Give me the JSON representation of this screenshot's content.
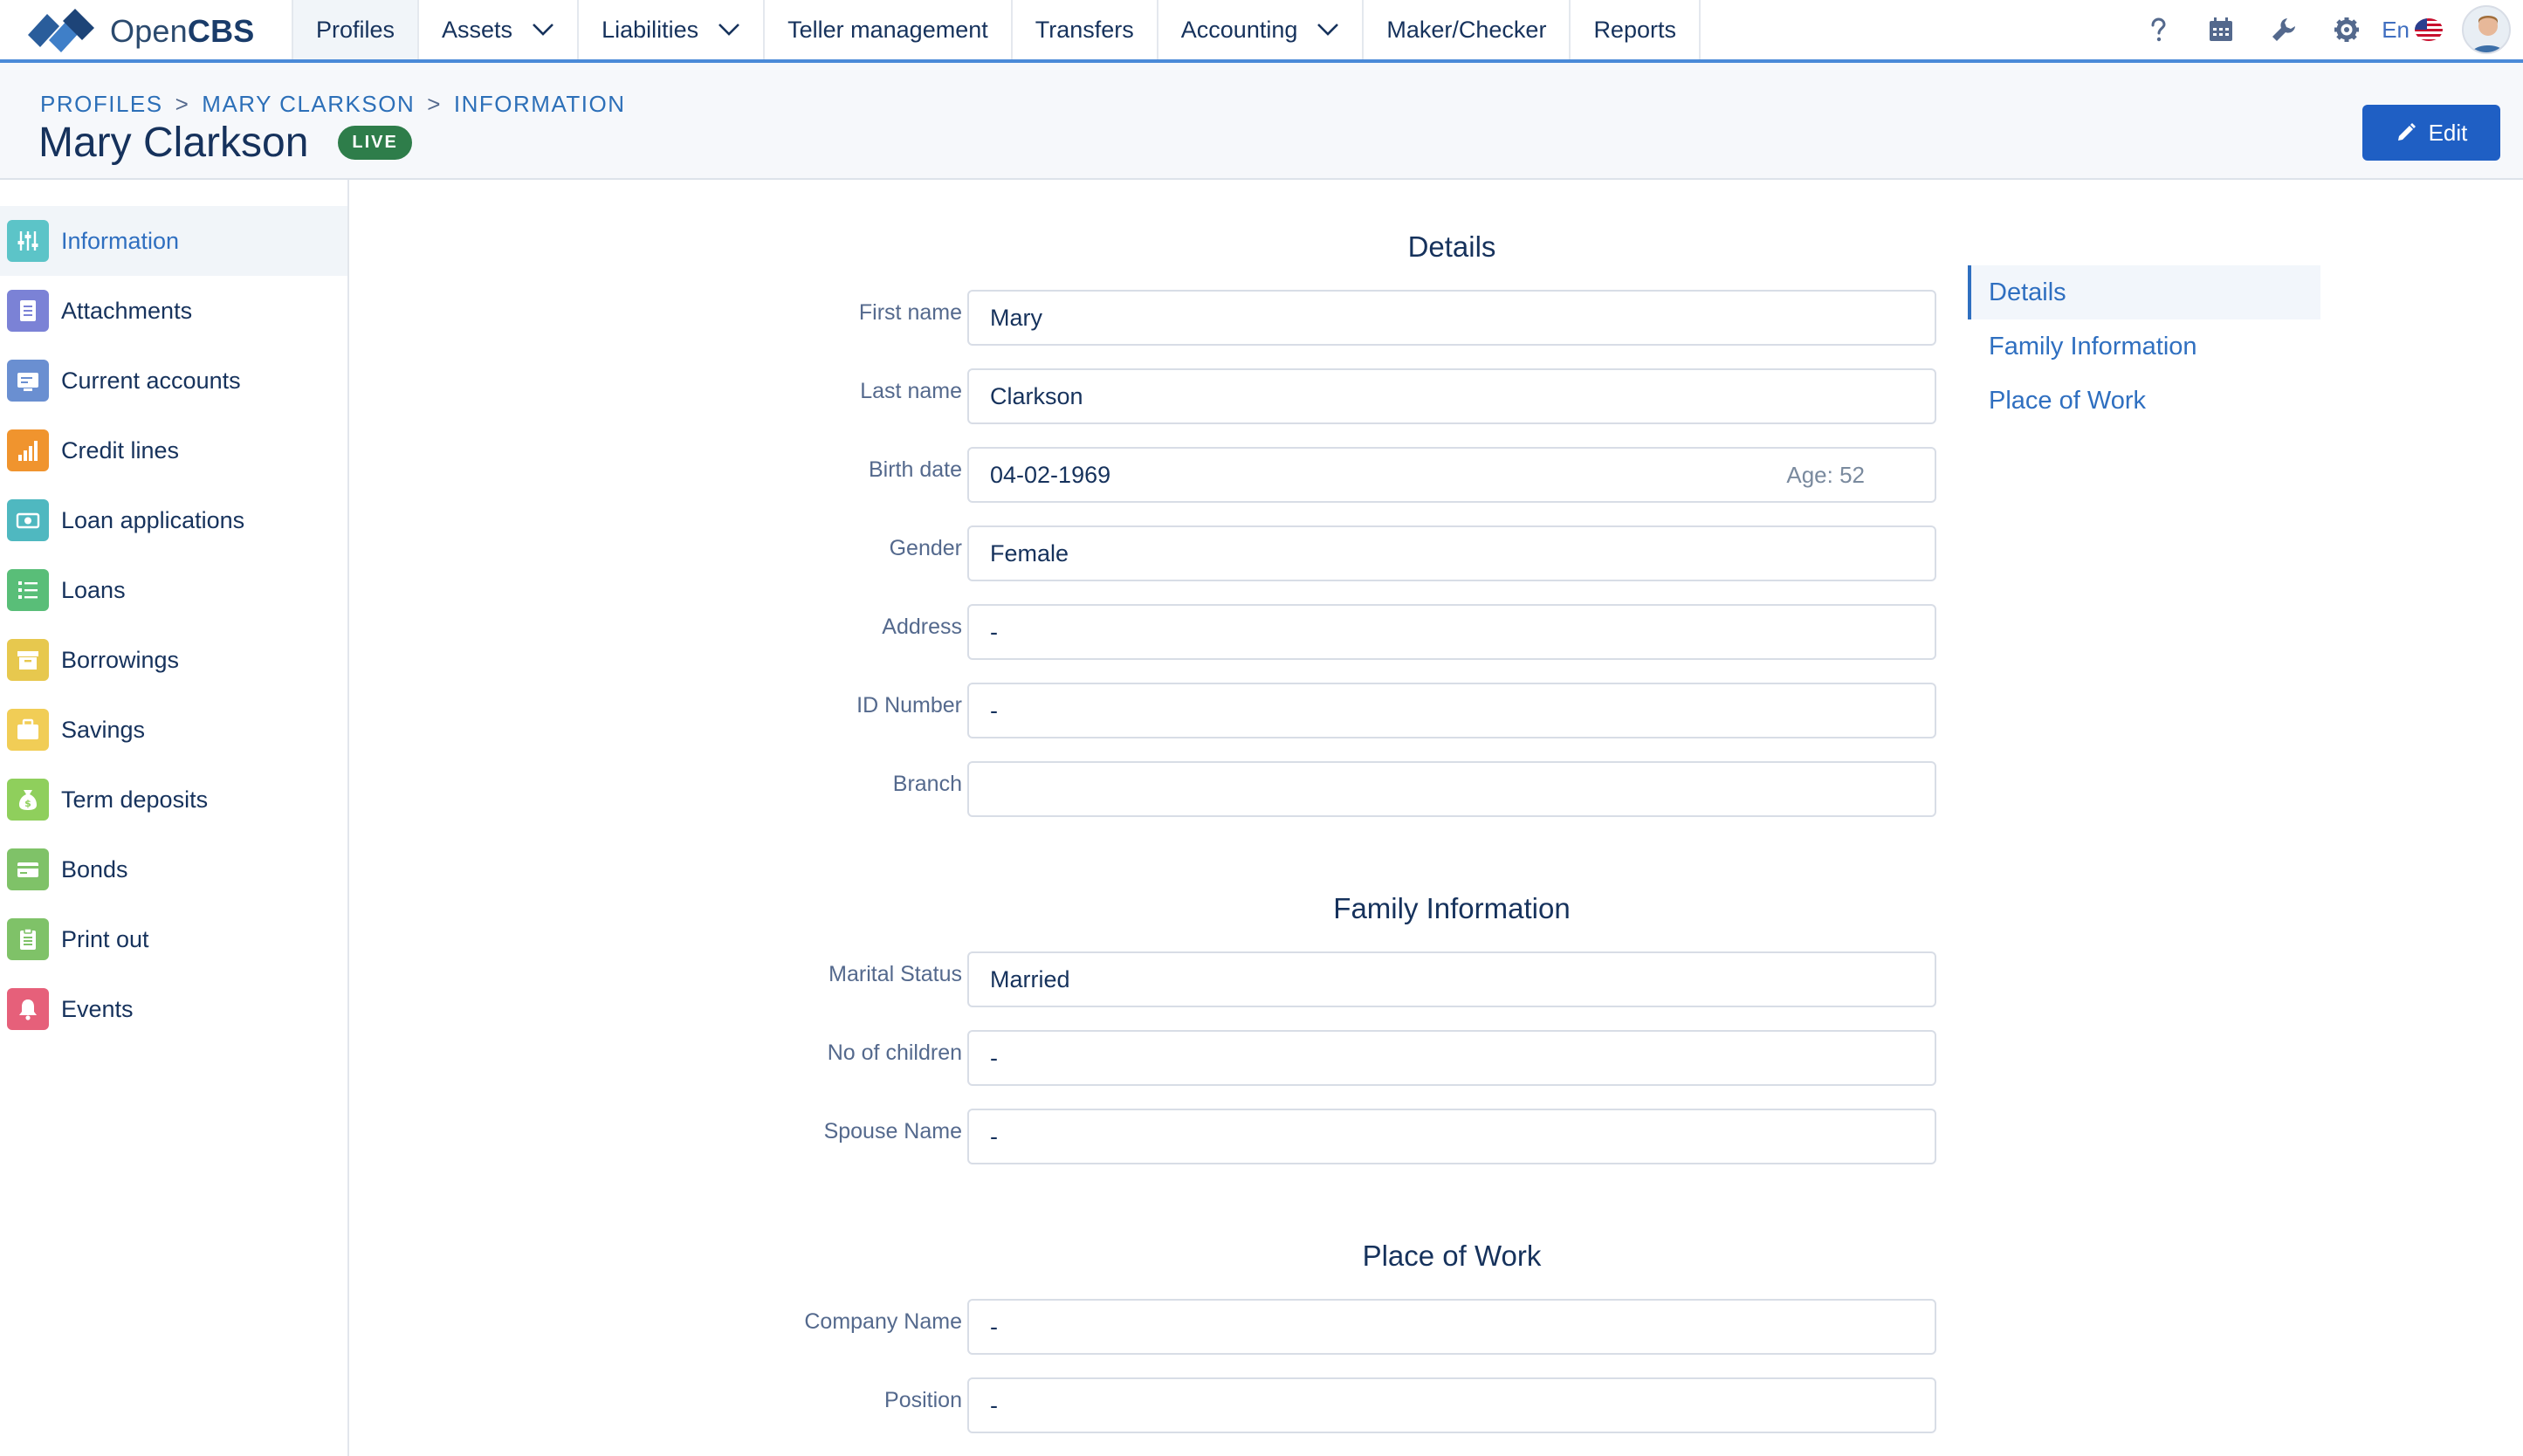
{
  "app": {
    "logo_prefix": "Open",
    "logo_suffix": "CBS"
  },
  "nav": {
    "items": [
      {
        "label": "Profiles",
        "has_menu": false,
        "active": true
      },
      {
        "label": "Assets",
        "has_menu": true
      },
      {
        "label": "Liabilities",
        "has_menu": true
      },
      {
        "label": "Teller management",
        "has_menu": false
      },
      {
        "label": "Transfers",
        "has_menu": false
      },
      {
        "label": "Accounting",
        "has_menu": true
      },
      {
        "label": "Maker/Checker",
        "has_menu": false
      },
      {
        "label": "Reports",
        "has_menu": false
      }
    ],
    "tools": [
      "help-icon",
      "calendar-icon",
      "wrench-icon",
      "gear-icon"
    ],
    "language": "En"
  },
  "header": {
    "breadcrumb": [
      "PROFILES",
      "MARY CLARKSON",
      "INFORMATION"
    ],
    "breadcrumb_sep": ">",
    "title": "Mary Clarkson",
    "status_badge": "LIVE",
    "edit_label": "Edit"
  },
  "sidebar": {
    "items": [
      {
        "label": "Information",
        "icon": "sliders-icon",
        "color": "#5cc4c8",
        "active": true
      },
      {
        "label": "Attachments",
        "icon": "document-icon",
        "color": "#7b82d6"
      },
      {
        "label": "Current accounts",
        "icon": "card-icon",
        "color": "#6a8fd1"
      },
      {
        "label": "Credit lines",
        "icon": "bar-chart-icon",
        "color": "#f0942e"
      },
      {
        "label": "Loan applications",
        "icon": "cash-icon",
        "color": "#4fb8c0"
      },
      {
        "label": "Loans",
        "icon": "checklist-icon",
        "color": "#59be78"
      },
      {
        "label": "Borrowings",
        "icon": "archive-icon",
        "color": "#e7c84e"
      },
      {
        "label": "Savings",
        "icon": "briefcase-icon",
        "color": "#f1cd56"
      },
      {
        "label": "Term deposits",
        "icon": "money-bag-icon",
        "color": "#8fcf5c"
      },
      {
        "label": "Bonds",
        "icon": "wallet-icon",
        "color": "#7fc268"
      },
      {
        "label": "Print out",
        "icon": "clipboard-icon",
        "color": "#7fc268"
      },
      {
        "label": "Events",
        "icon": "bell-icon",
        "color": "#e6607a"
      }
    ]
  },
  "sections": {
    "details": {
      "title": "Details",
      "fields": [
        {
          "label": "First name",
          "value": "Mary"
        },
        {
          "label": "Last name",
          "value": "Clarkson"
        },
        {
          "label": "Birth date",
          "value": "04-02-1969",
          "extra": "Age: 52"
        },
        {
          "label": "Gender",
          "value": "Female"
        },
        {
          "label": "Address",
          "value": "-"
        },
        {
          "label": "ID Number",
          "value": "-"
        },
        {
          "label": "Branch",
          "value": ""
        }
      ]
    },
    "family": {
      "title": "Family Information",
      "fields": [
        {
          "label": "Marital Status",
          "value": "Married"
        },
        {
          "label": "No of children",
          "value": "-"
        },
        {
          "label": "Spouse Name",
          "value": "-"
        }
      ]
    },
    "work": {
      "title": "Place of Work",
      "fields": [
        {
          "label": "Company Name",
          "value": "-"
        },
        {
          "label": "Position",
          "value": "-"
        }
      ]
    }
  },
  "anchor_nav": {
    "items": [
      {
        "label": "Details",
        "active": true
      },
      {
        "label": "Family Information"
      },
      {
        "label": "Place of Work"
      }
    ]
  }
}
